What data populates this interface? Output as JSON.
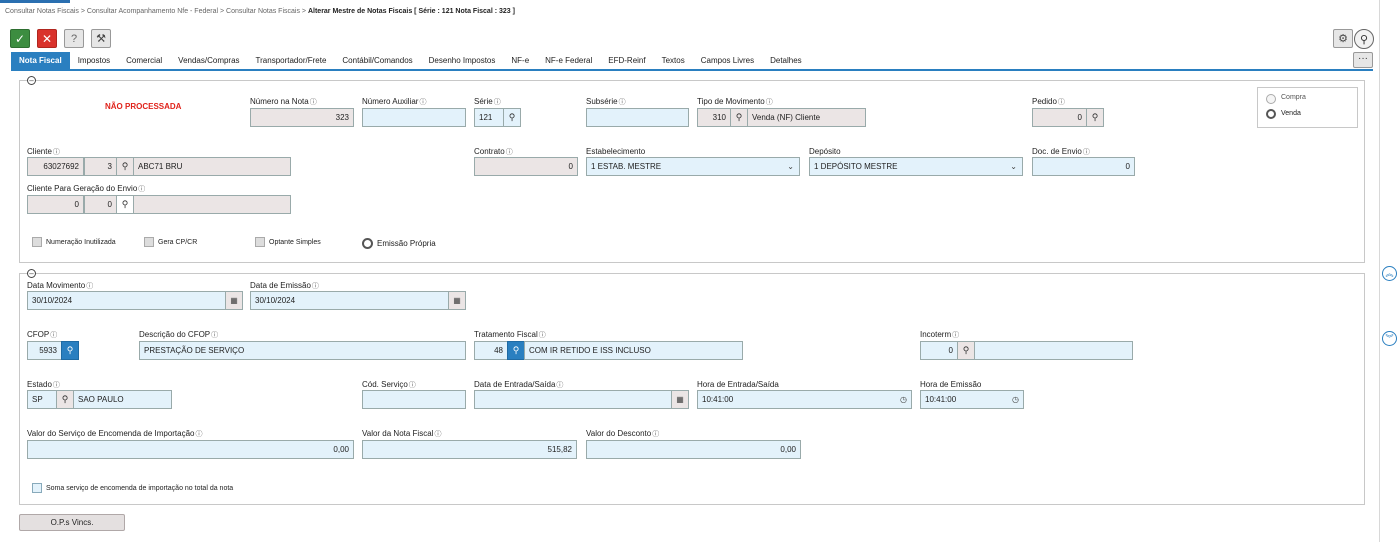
{
  "breadcrumb": {
    "items": [
      "Consultar Notas Fiscais",
      "Consultar Acompanhamento Nfe - Federal",
      "Consultar Notas Fiscais"
    ],
    "separator": ">",
    "current": "Alterar Mestre de Notas Fiscais [ Série : 121 Nota Fiscal : 323 ]"
  },
  "toolbar": {
    "confirm": "✓",
    "cancel": "✕",
    "help": "?",
    "tools": "⚒",
    "settings": "⚙",
    "search": "⚲",
    "more": "···"
  },
  "tabs": [
    "Nota Fiscal",
    "Impostos",
    "Comercial",
    "Vendas/Compras",
    "Transportador/Frete",
    "Contábil/Comandos",
    "Desenho Impostos",
    "NF-e",
    "NF-e Federal",
    "EFD-Reinf",
    "Textos",
    "Campos Livres",
    "Detalhes"
  ],
  "icons": {
    "info": "ⓘ",
    "search": "⚲",
    "dropdown": "⌄",
    "calendar": "▦",
    "clock": "◷",
    "collapse": "–",
    "up": "︽",
    "down": "︾"
  },
  "section1": {
    "status": "NÃO PROCESSADA",
    "numero_nota": {
      "label": "Número na Nota",
      "value": "323"
    },
    "numero_auxiliar": {
      "label": "Número Auxiliar",
      "value": ""
    },
    "serie": {
      "label": "Série",
      "value": "121"
    },
    "subserie": {
      "label": "Subsérie",
      "value": ""
    },
    "tipo_movimento": {
      "label": "Tipo de Movimento",
      "code": "310",
      "desc": "Venda (NF) Cliente"
    },
    "pedido": {
      "label": "Pedido",
      "value": "0"
    },
    "operacao": {
      "compra": "Compra",
      "venda": "Venda",
      "selected": "Venda"
    },
    "cliente": {
      "label": "Cliente",
      "code": "63027692",
      "sub": "3",
      "name": "ABC71 BRU"
    },
    "contrato": {
      "label": "Contrato",
      "value": "0"
    },
    "estabelecimento": {
      "label": "Estabelecimento",
      "value": "1 ESTAB. MESTRE"
    },
    "deposito": {
      "label": "Depósito",
      "value": "1 DEPÓSITO MESTRE"
    },
    "doc_envio": {
      "label": "Doc. de Envio",
      "value": "0"
    },
    "cliente_envio": {
      "label": "Cliente Para Geração do Envio",
      "code": "0",
      "sub": "0",
      "name": ""
    },
    "checks": {
      "numeracao_inutilizada": "Numeração Inutilizada",
      "gera_cpcr": "Gera CP/CR",
      "optante_simples": "Optante Simples",
      "emissao_propria": "Emissão Própria"
    }
  },
  "section2": {
    "data_movimento": {
      "label": "Data Movimento",
      "value": "30/10/2024"
    },
    "data_emissao": {
      "label": "Data de Emissão",
      "value": "30/10/2024"
    },
    "cfop": {
      "label": "CFOP",
      "value": "5933"
    },
    "descricao_cfop": {
      "label": "Descrição do CFOP",
      "value": "PRESTAÇÃO DE SERVIÇO"
    },
    "tratamento_fiscal": {
      "label": "Tratamento Fiscal",
      "code": "48",
      "desc": "COM IR RETIDO E ISS INCLUSO"
    },
    "incoterm": {
      "label": "Incoterm",
      "code": "0",
      "desc": ""
    },
    "estado": {
      "label": "Estado",
      "code": "SP",
      "name": "SAO PAULO"
    },
    "cod_servico": {
      "label": "Cód. Serviço",
      "value": ""
    },
    "data_entrada_saida": {
      "label": "Data de Entrada/Saída",
      "value": ""
    },
    "hora_entrada_saida": {
      "label": "Hora de Entrada/Saída",
      "value": "10:41:00"
    },
    "hora_emissao": {
      "label": "Hora de Emissão",
      "value": "10:41:00"
    },
    "valor_servico_importacao": {
      "label": "Valor do Serviço de Encomenda de Importação",
      "value": "0,00"
    },
    "valor_nota": {
      "label": "Valor da Nota Fiscal",
      "value": "515,82"
    },
    "valor_desconto": {
      "label": "Valor do Desconto",
      "value": "0,00"
    },
    "soma_servico": "Soma serviço de encomenda de importação no total da nota"
  },
  "ops_button": "O.P.s Vincs."
}
